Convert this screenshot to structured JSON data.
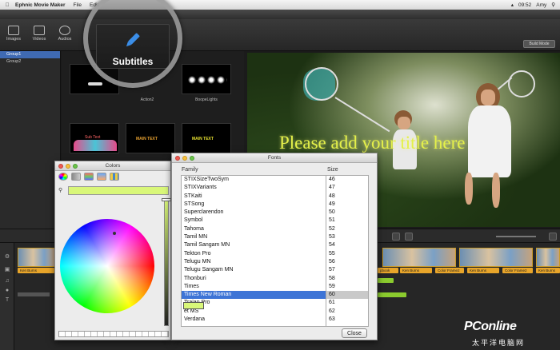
{
  "menubar": {
    "app_name": "Ephnic Movie Maker",
    "items": [
      "File",
      "Edit"
    ],
    "clock": "09:52",
    "user": "Amy"
  },
  "toolbar": {
    "buttons": [
      "Images",
      "Videos",
      "Audios"
    ],
    "build_mode": "Build Mode"
  },
  "left_panel": {
    "groups": [
      "Group1",
      "Group2"
    ],
    "selected_index": 0
  },
  "thumbnails": {
    "labels": [
      "Action2",
      "BoopeLights"
    ],
    "text_samples": [
      "MAIN TEXT",
      "MAIN TEXT",
      "Sub Text"
    ]
  },
  "magnifier": {
    "label": "Subtitles",
    "icon": "pencil-icon"
  },
  "preview": {
    "title": "Please add your title here",
    "title_color": "#e4f04a"
  },
  "timeline": {
    "tags": [
      "Ken Burns",
      "Ken Burns",
      "Ken Burns",
      "Ken Burns",
      "Color Frame2",
      "Color Frame2",
      "Ken Burns",
      "Ken Burns"
    ],
    "tag_partial": "pbook"
  },
  "colors_panel": {
    "title": "Colors",
    "current_color": "#d9f779"
  },
  "fonts_panel": {
    "title": "Fonts",
    "family_header": "Family",
    "size_header": "Size",
    "families": [
      "STIXSizeTwoSym",
      "STIXVariants",
      "STKaiti",
      "STSong",
      "Superclarendon",
      "Symbol",
      "Tahoma",
      "Tamil MN",
      "Tamil Sangam MN",
      "Tekton Pro",
      "Telugu MN",
      "Telugu Sangam MN",
      "Thonburi",
      "Times",
      "Times New Roman",
      "Trajan Pro",
      "et MS",
      "Verdana"
    ],
    "selected_family": "Times New Roman",
    "sizes": [
      "46",
      "47",
      "48",
      "49",
      "50",
      "51",
      "52",
      "53",
      "54",
      "55",
      "56",
      "57",
      "58",
      "59",
      "60",
      "61",
      "62",
      "63"
    ],
    "selected_size": "60",
    "close_label": "Close"
  },
  "watermark": {
    "main": "PConline",
    "sub": "太平洋电脑网"
  }
}
